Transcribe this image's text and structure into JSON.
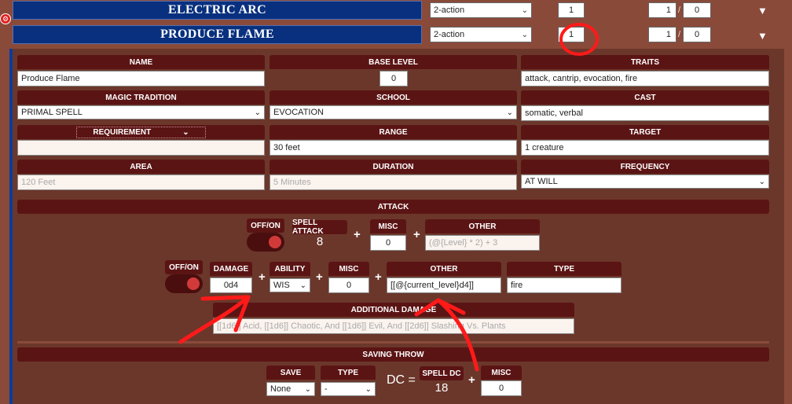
{
  "spells": [
    {
      "name": "ELECTRIC ARC",
      "action": "2-action",
      "level": "1",
      "uses_a": "1",
      "uses_b": "0"
    },
    {
      "name": "PRODUCE FLAME",
      "action": "2-action",
      "level": "1",
      "uses_a": "1",
      "uses_b": "0"
    }
  ],
  "slash": "/",
  "fields": {
    "name_label": "NAME",
    "name_value": "Produce Flame",
    "base_level_label": "BASE LEVEL",
    "base_level_value": "0",
    "traits_label": "TRAITS",
    "traits_value": "attack, cantrip, evocation, fire",
    "tradition_label": "MAGIC TRADITION",
    "tradition_value": "PRIMAL SPELL",
    "school_label": "SCHOOL",
    "school_value": "EVOCATION",
    "cast_label": "CAST",
    "cast_value": "somatic, verbal",
    "requirement_label": "REQUIREMENT",
    "requirement_value": "",
    "range_label": "RANGE",
    "range_value": "30 feet",
    "target_label": "TARGET",
    "target_value": "1 creature",
    "area_label": "AREA",
    "area_placeholder": "120 Feet",
    "duration_label": "DURATION",
    "duration_placeholder": "5 Minutes",
    "frequency_label": "FREQUENCY",
    "frequency_value": "AT WILL"
  },
  "attack": {
    "section_label": "ATTACK",
    "toggle_label": "OFF/ON",
    "spell_attack_label": "SPELL ATTACK",
    "spell_attack_value": "8",
    "misc_label": "MISC",
    "misc_value": "0",
    "other_label": "OTHER",
    "other_placeholder": "(@{Level} * 2) + 3",
    "plus": "+"
  },
  "damage": {
    "toggle_label": "OFF/ON",
    "damage_label": "DAMAGE",
    "damage_value": "0d4",
    "ability_label": "ABILITY",
    "ability_value": "WIS",
    "misc_label": "MISC",
    "misc_value": "0",
    "other_label": "OTHER",
    "other_value": "[[@{current_level}d4]]",
    "type_label": "TYPE",
    "type_value": "fire",
    "additional_label": "ADDITIONAL DAMAGE",
    "additional_placeholder": "[[1d6]] Acid, [[1d6]] Chaotic, And [[1d6]] Evil, And [[2d6]] Slashing Vs. Plants"
  },
  "saving": {
    "section_label": "SAVING THROW",
    "save_label": "SAVE",
    "save_value": "None",
    "type_label": "TYPE",
    "type_value": "-",
    "dc_label": "DC =",
    "spell_dc_label": "SPELL DC",
    "spell_dc_value": "18",
    "misc_label": "MISC",
    "misc_value": "0"
  },
  "icons": {
    "dropdown": "chevron-down-icon",
    "expand": "triangle-down-icon",
    "settings": "gear-icon"
  },
  "colors": {
    "header": "#5b1414",
    "spell_bar": "#08307f",
    "panel": "#6b372b",
    "background": "#8a4a3a",
    "annotation": "#ff1a1a",
    "toggle_knob": "#d23a3a"
  }
}
